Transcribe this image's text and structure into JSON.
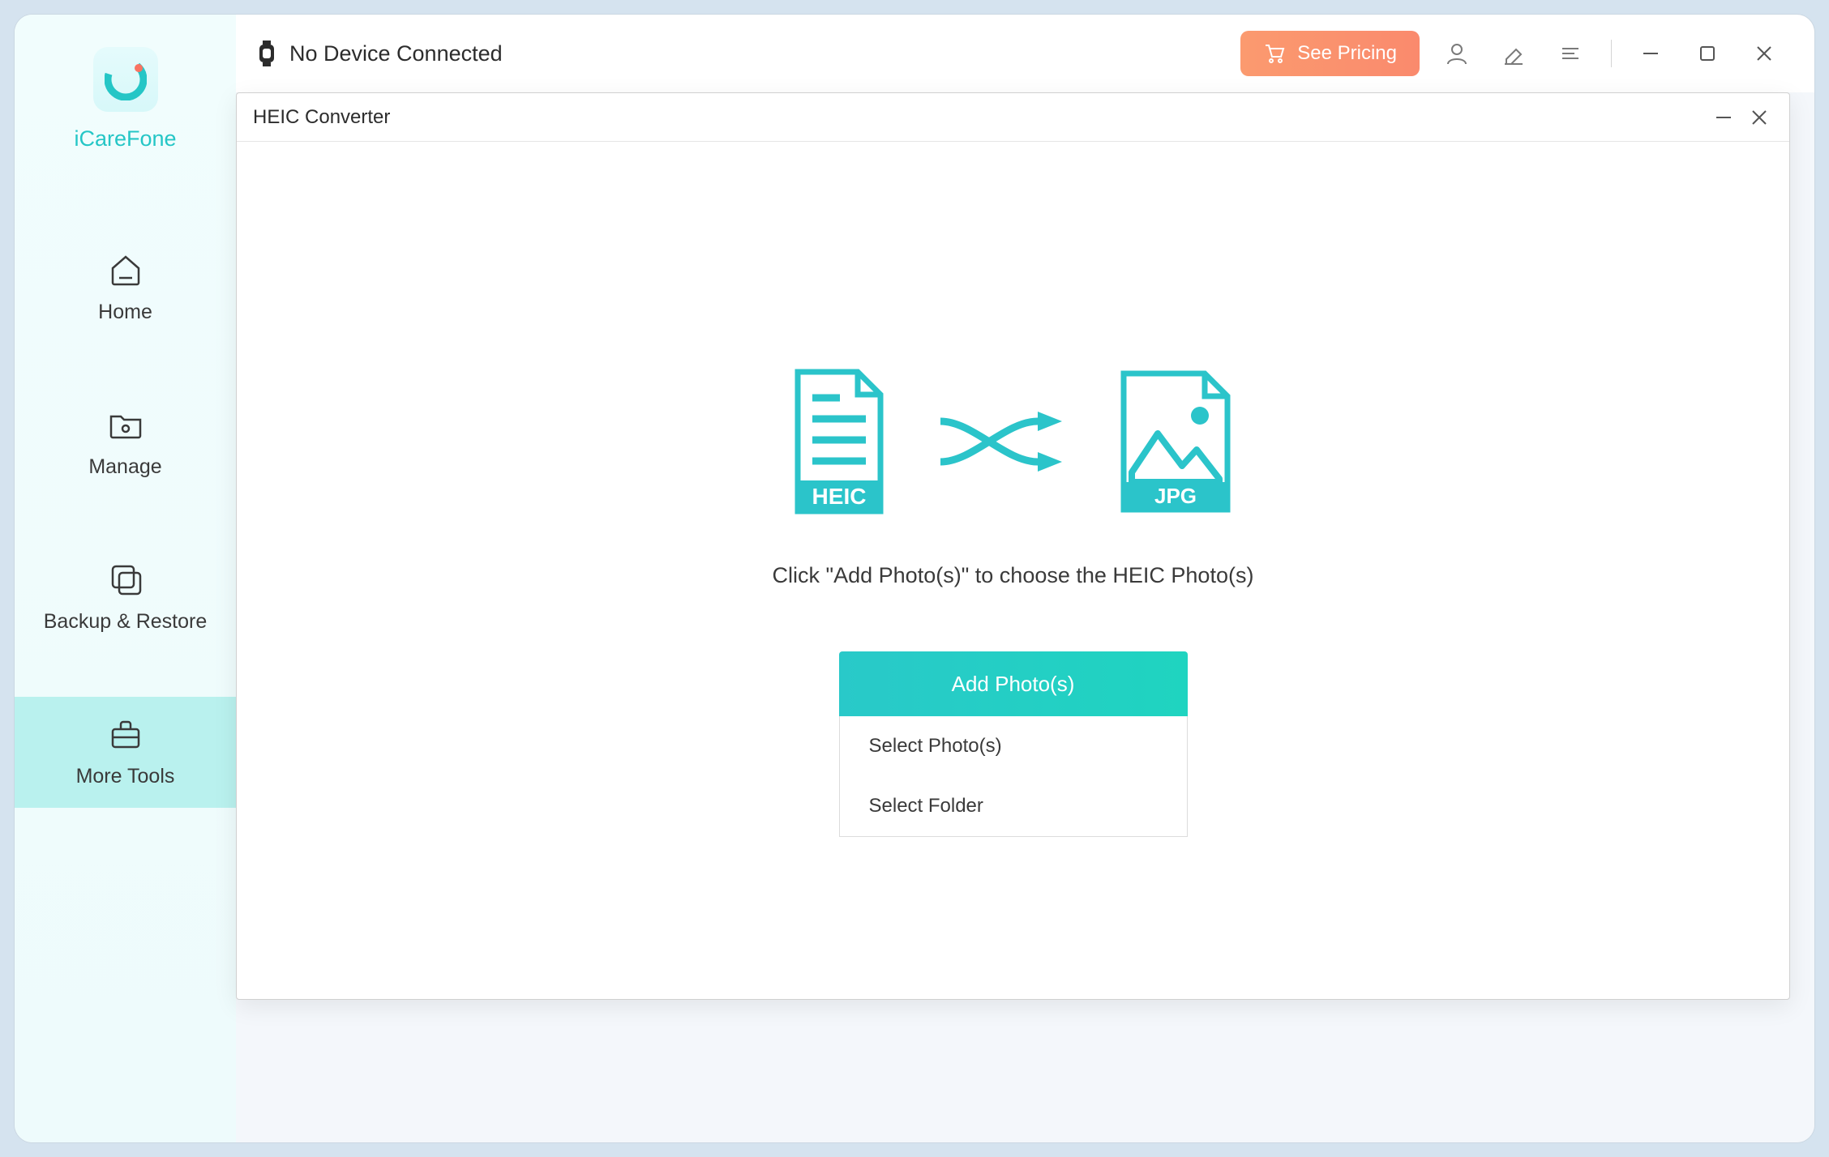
{
  "brand": "iCareFone",
  "device_status": "No Device Connected",
  "pricing_label": "See Pricing",
  "sidebar": {
    "items": [
      {
        "label": "Home"
      },
      {
        "label": "Manage"
      },
      {
        "label": "Backup & Restore"
      },
      {
        "label": "More Tools"
      }
    ]
  },
  "modal": {
    "title": "HEIC Converter",
    "heic_label": "HEIC",
    "jpg_label": "JPG",
    "instruction": "Click \"Add Photo(s)\" to choose the HEIC Photo(s)",
    "add_button": "Add Photo(s)",
    "options": [
      "Select Photo(s)",
      "Select Folder"
    ]
  },
  "colors": {
    "accent": "#25c6c6",
    "pricing": "#fa8a6d"
  }
}
